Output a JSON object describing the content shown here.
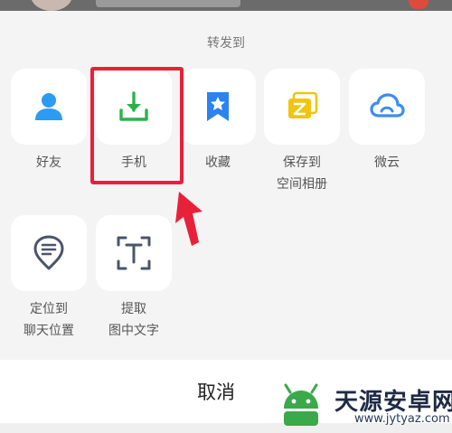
{
  "share_sheet": {
    "title": "转发到",
    "row1": [
      {
        "label": "好友",
        "icon": "person-icon"
      },
      {
        "label": "手机",
        "icon": "download-icon"
      },
      {
        "label": "收藏",
        "icon": "bookmark-star-icon"
      },
      {
        "label_line1": "保存到",
        "label_line2": "空间相册",
        "icon": "album-icon"
      },
      {
        "label": "微云",
        "icon": "cloud-icon"
      }
    ],
    "row2": [
      {
        "label_line1": "定位到",
        "label_line2": "聊天位置",
        "icon": "location-message-icon"
      },
      {
        "label_line1": "提取",
        "label_line2": "图中文字",
        "icon": "text-scan-icon"
      }
    ],
    "cancel_label": "取消"
  },
  "watermark": {
    "text": "天源安卓网",
    "url": "www.jytyaz.com"
  },
  "colors": {
    "friend": "#2b9cf0",
    "phone": "#2bb24c",
    "favorite": "#2b82f0",
    "album": "#f1c40f",
    "cloud": "#3a8ef0",
    "highlight": "#e8213b",
    "icon_gray": "#4a5568"
  }
}
